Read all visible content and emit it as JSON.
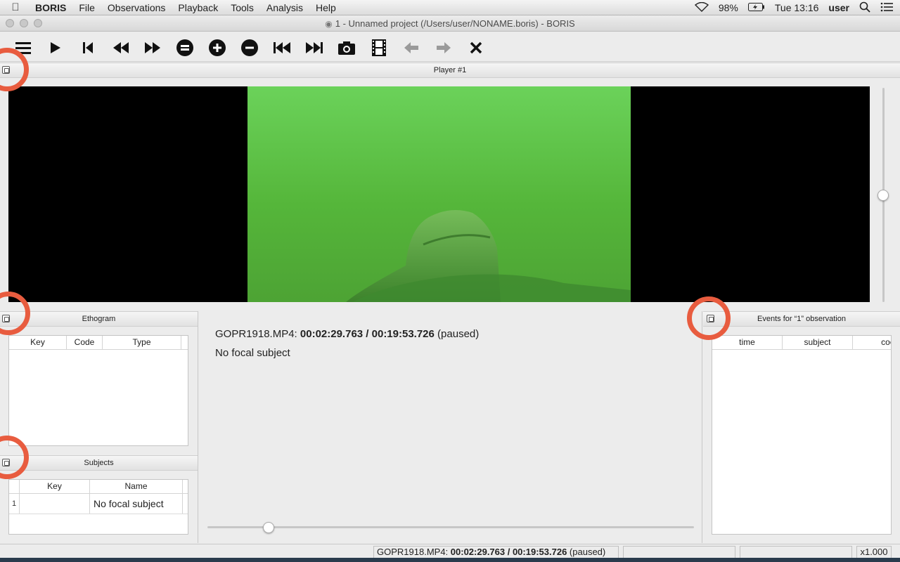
{
  "menubar": {
    "apple": "",
    "items": [
      "BORIS",
      "File",
      "Observations",
      "Playback",
      "Tools",
      "Analysis",
      "Help"
    ],
    "battery": "98%",
    "clock": "Tue 13:16",
    "user": "user"
  },
  "window": {
    "title": "1 - Unnamed project (/Users/user/NONAME.boris) - BORIS"
  },
  "toolbar": {
    "icons": [
      "menu-icon",
      "play-icon",
      "jump-to-start-icon",
      "rewind-icon",
      "fast-forward-icon",
      "equal-speed-icon",
      "speed-up-icon",
      "speed-down-icon",
      "previous-media-icon",
      "next-media-icon",
      "snapshot-icon",
      "frame-by-frame-icon",
      "back-icon",
      "forward-icon",
      "close-icon"
    ]
  },
  "player": {
    "title": "Player #1",
    "volume_level": 0.5
  },
  "ethogram": {
    "title": "Ethogram",
    "columns": [
      "Key",
      "Code",
      "Type"
    ],
    "rows": []
  },
  "subjects": {
    "title": "Subjects",
    "columns": [
      "Key",
      "Name"
    ],
    "rows": [
      {
        "index": "1",
        "key": "",
        "name": "No focal subject"
      }
    ]
  },
  "events": {
    "title": "Events for “1” observation",
    "columns": [
      "time",
      "subject",
      "coc"
    ],
    "rows": []
  },
  "center": {
    "media_file": "GOPR1918.MP4:",
    "time": "00:02:29.763 / 00:19:53.726",
    "state": "(paused)",
    "focal_subject": "No focal subject",
    "position_fraction": 0.126
  },
  "statusbar": {
    "media_file": "GOPR1918.MP4:",
    "time": "00:02:29.763 / 00:19:53.726",
    "state": "(paused)",
    "cell2": "",
    "cell3": "",
    "speed": "x1.000"
  }
}
